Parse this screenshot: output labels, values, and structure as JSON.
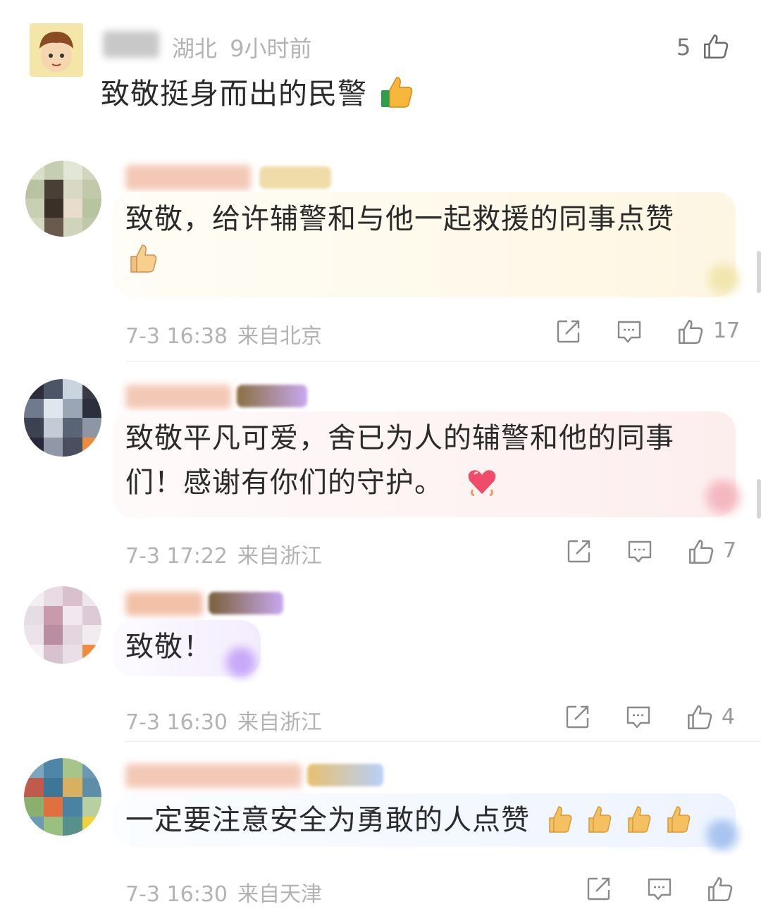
{
  "top_comment": {
    "location": "湖北",
    "time": "9小时前",
    "likes": "5",
    "text": "致敬挺身而出的民警",
    "emoji": "thumbs-up-icon"
  },
  "replies": [
    {
      "text_line1": "致敬，给许辅警和与他一起救援的同事点赞",
      "emoji": "thumbs-up-icon",
      "date": "7-3 16:38",
      "source": "来自北京",
      "likes": "17"
    },
    {
      "text_line1": "致敬平凡可爱，舍已为人的辅警和他的同事",
      "text_line2": "们！感谢有你们的守护。",
      "emoji": "heart-icon",
      "date": "7-3 17:22",
      "source": "来自浙江",
      "likes": "7"
    },
    {
      "text_line1": "致敬！",
      "date": "7-3 16:30",
      "source": "来自浙江",
      "likes": "4"
    },
    {
      "text_line1": "一定要注意安全为勇敢的人点赞",
      "emoji": "thumbs-up-icon",
      "date": "7-3 16:30",
      "source": "来自天津"
    }
  ],
  "colors": {
    "meta_text": "#b3b3b3",
    "body_text": "#2b2b2b",
    "icon_stroke": "#8a8a8a",
    "bubble_yellow": "#fdf8e6",
    "bubble_pink": "#fdeff0",
    "bubble_lavender": "#f4efff",
    "bubble_blue": "#eef4ff"
  }
}
